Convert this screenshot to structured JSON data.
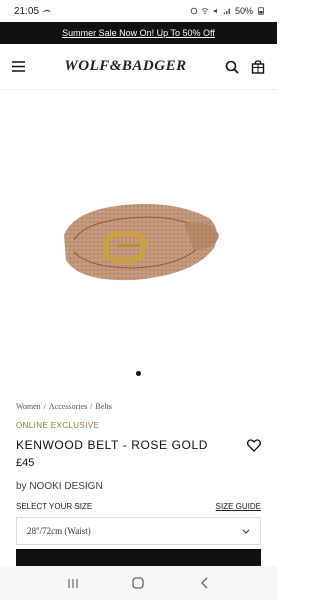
{
  "status": {
    "time": "21:05",
    "battery": "50%"
  },
  "promo": {
    "text": "Summer Sale Now On! Up To 50% Off"
  },
  "header": {
    "logo": "WOLF&BADGER"
  },
  "breadcrumb": [
    "Women",
    "/",
    "Accessories",
    "/",
    "Belts"
  ],
  "product": {
    "badge": "ONLINE EXCLUSIVE",
    "title": "KENWOOD BELT - ROSE GOLD",
    "price": "£45",
    "brand": "by NOOKI DESIGN",
    "size_label": "SELECT YOUR SIZE",
    "size_guide": "SIZE GUIDE",
    "selected_size": "28\"/72cm (Waist)"
  },
  "colors": {
    "banner": "#111111",
    "badge": "#8a7a3a",
    "belt": "#b8876a",
    "buckle": "#c9a33a"
  }
}
